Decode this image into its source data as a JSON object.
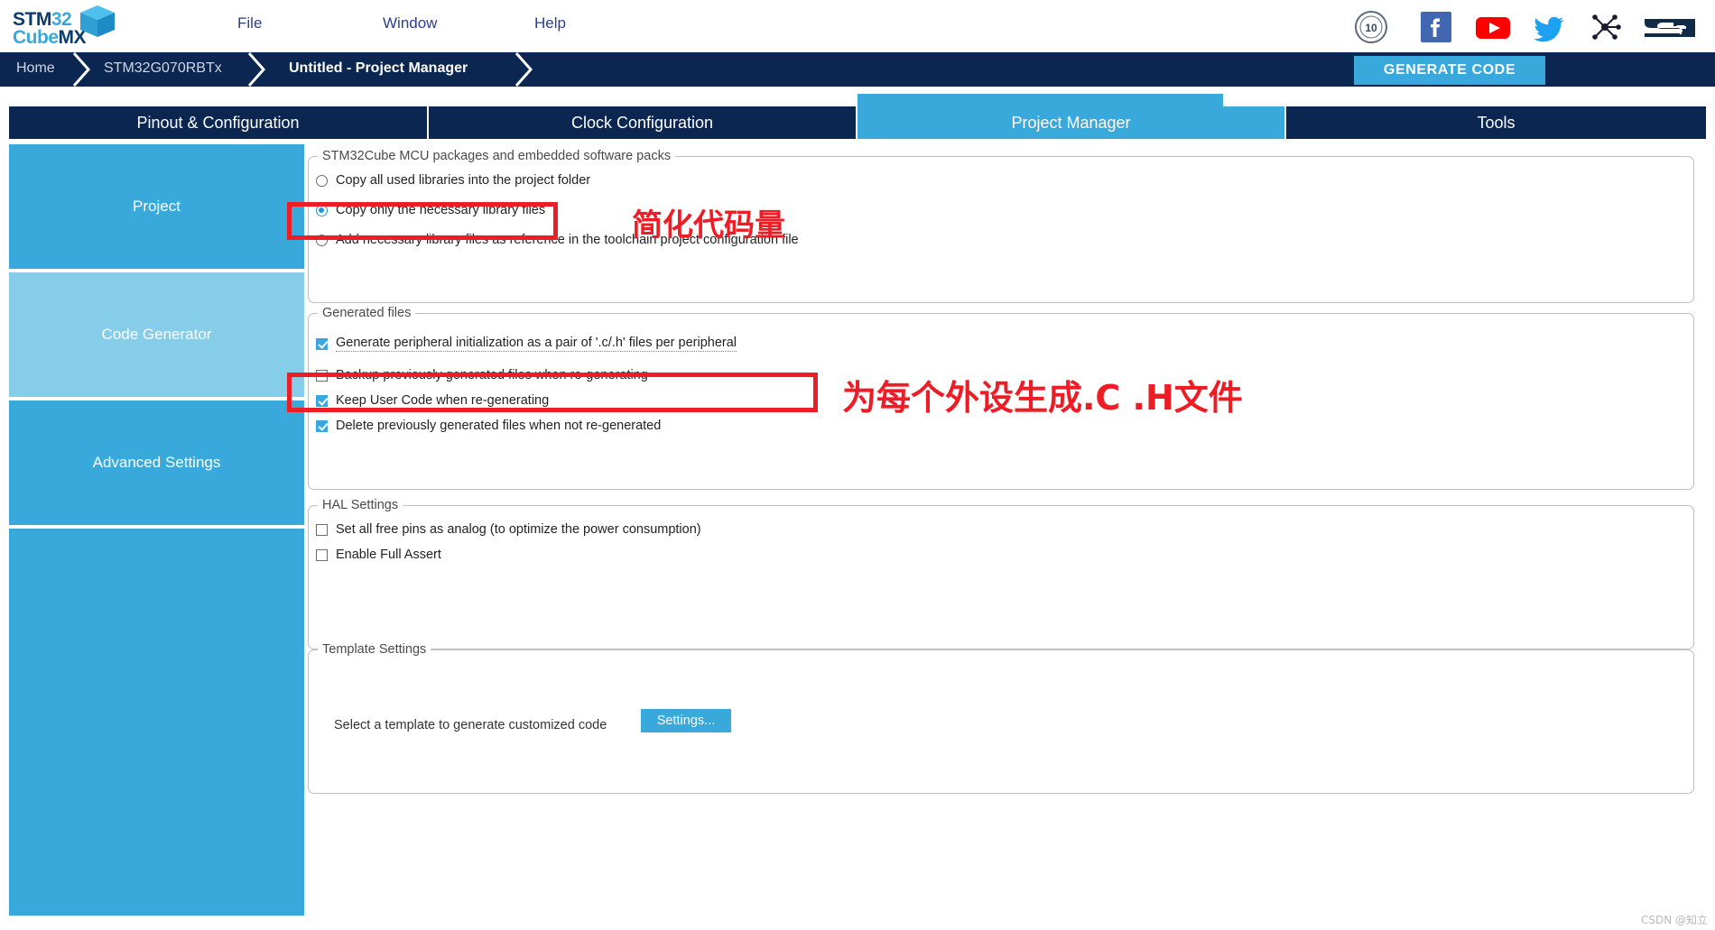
{
  "app": {
    "logo_stm": "STM",
    "logo_32": "32",
    "logo_cube": "Cube",
    "logo_mx": "MX"
  },
  "menu": {
    "items": [
      {
        "label": "File",
        "name": "menu-file"
      },
      {
        "label": "Window",
        "name": "menu-window"
      },
      {
        "label": "Help",
        "name": "menu-help"
      }
    ]
  },
  "social_icons": [
    {
      "name": "ten-years-badge-icon",
      "label": "10"
    },
    {
      "name": "facebook-icon",
      "label": "f"
    },
    {
      "name": "youtube-icon",
      "label": ""
    },
    {
      "name": "twitter-icon",
      "label": ""
    },
    {
      "name": "community-network-icon",
      "label": ""
    },
    {
      "name": "st-logo-icon",
      "label": ""
    }
  ],
  "breadcrumb": {
    "home": "Home",
    "device": "STM32G070RBTx",
    "project": "Untitled - Project Manager"
  },
  "toolbar": {
    "generate_code_label": "GENERATE CODE"
  },
  "tabs": [
    {
      "label": "Pinout & Configuration",
      "selected": false
    },
    {
      "label": "Clock Configuration",
      "selected": false
    },
    {
      "label": "Project Manager",
      "selected": true
    },
    {
      "label": "Tools",
      "selected": false
    }
  ],
  "sidebar": {
    "items": [
      {
        "label": "Project",
        "selected": false
      },
      {
        "label": "Code Generator",
        "selected": true
      },
      {
        "label": "Advanced Settings",
        "selected": false
      }
    ]
  },
  "groups": {
    "packs": {
      "title": "STM32Cube MCU packages and embedded software packs",
      "options": [
        {
          "label": "Copy all used libraries into the project folder",
          "checked": false
        },
        {
          "label": "Copy only the necessary library files",
          "checked": true
        },
        {
          "label": "Add necessary library files as reference in the toolchain project configuration file",
          "checked": false
        }
      ]
    },
    "generated": {
      "title": "Generated files",
      "options": [
        {
          "label": "Generate peripheral initialization as a pair of '.c/.h' files per peripheral",
          "checked": true
        },
        {
          "label": "Backup previously generated files when re-generating",
          "checked": false
        },
        {
          "label": "Keep User Code when re-generating",
          "checked": true
        },
        {
          "label": "Delete previously generated files when not re-generated",
          "checked": true
        }
      ]
    },
    "hal": {
      "title": "HAL Settings",
      "options": [
        {
          "label": "Set all free pins as analog (to optimize the power consumption)",
          "checked": false
        },
        {
          "label": "Enable Full Assert",
          "checked": false
        }
      ]
    },
    "template": {
      "title": "Template Settings",
      "description": "Select a template to generate customized code",
      "settings_button": "Settings..."
    }
  },
  "annotations": {
    "note_1": "简化代码量",
    "note_2": "为每个外设生成.C .H文件"
  },
  "watermark": "CSDN @知立",
  "colors": {
    "accent_blue": "#39a9dc",
    "dark_navy": "#0b2650",
    "selected_sidebar": "#86cdea",
    "annotation_red": "#ee1c25"
  }
}
